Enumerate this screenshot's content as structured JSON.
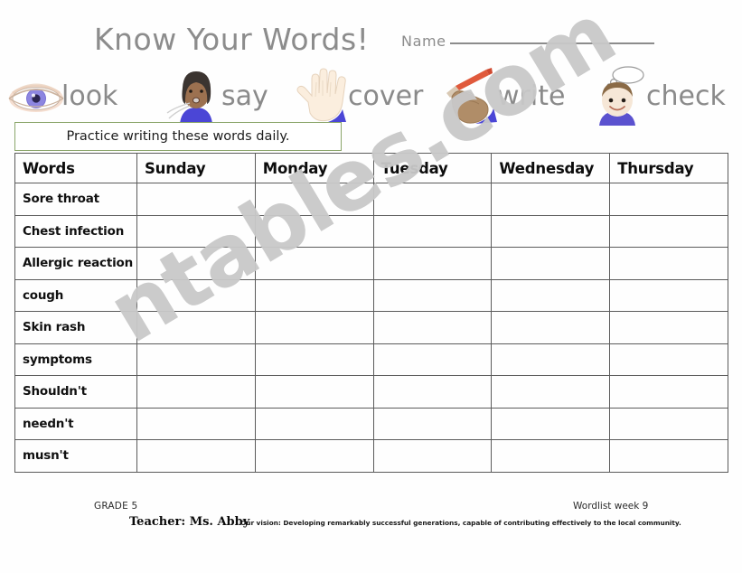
{
  "header": {
    "title": "Know Your Words!",
    "name_label": "Name",
    "name_value": ""
  },
  "steps": [
    {
      "label": "look",
      "icon": "eye-icon"
    },
    {
      "label": "say",
      "icon": "speaking-person-icon"
    },
    {
      "label": "cover",
      "icon": "open-hand-icon"
    },
    {
      "label": "write",
      "icon": "writing-hand-pencil-icon"
    },
    {
      "label": "check",
      "icon": "thinking-boy-icon"
    }
  ],
  "instruction": {
    "text": "Practice writing these words daily.",
    "border_color": "#8aa56a"
  },
  "table": {
    "columns": [
      "Words",
      "Sunday",
      "Monday",
      "Tuesday",
      "Wednesday",
      "Thursday"
    ],
    "rows": [
      "Sore throat",
      "Chest infection",
      "Allergic reaction",
      "cough",
      "Skin rash",
      "symptoms",
      "Shouldn't",
      "needn't",
      "musn't"
    ]
  },
  "footer": {
    "grade": "GRADE 5",
    "teacher": "Teacher: Ms. Abby",
    "vision": "Our vision: Developing remarkably successful generations, capable of contributing effectively to the local community.",
    "wordlist": "Wordlist week 9"
  },
  "watermark": {
    "text": "ntables.com",
    "color": "#c9c9c9"
  }
}
